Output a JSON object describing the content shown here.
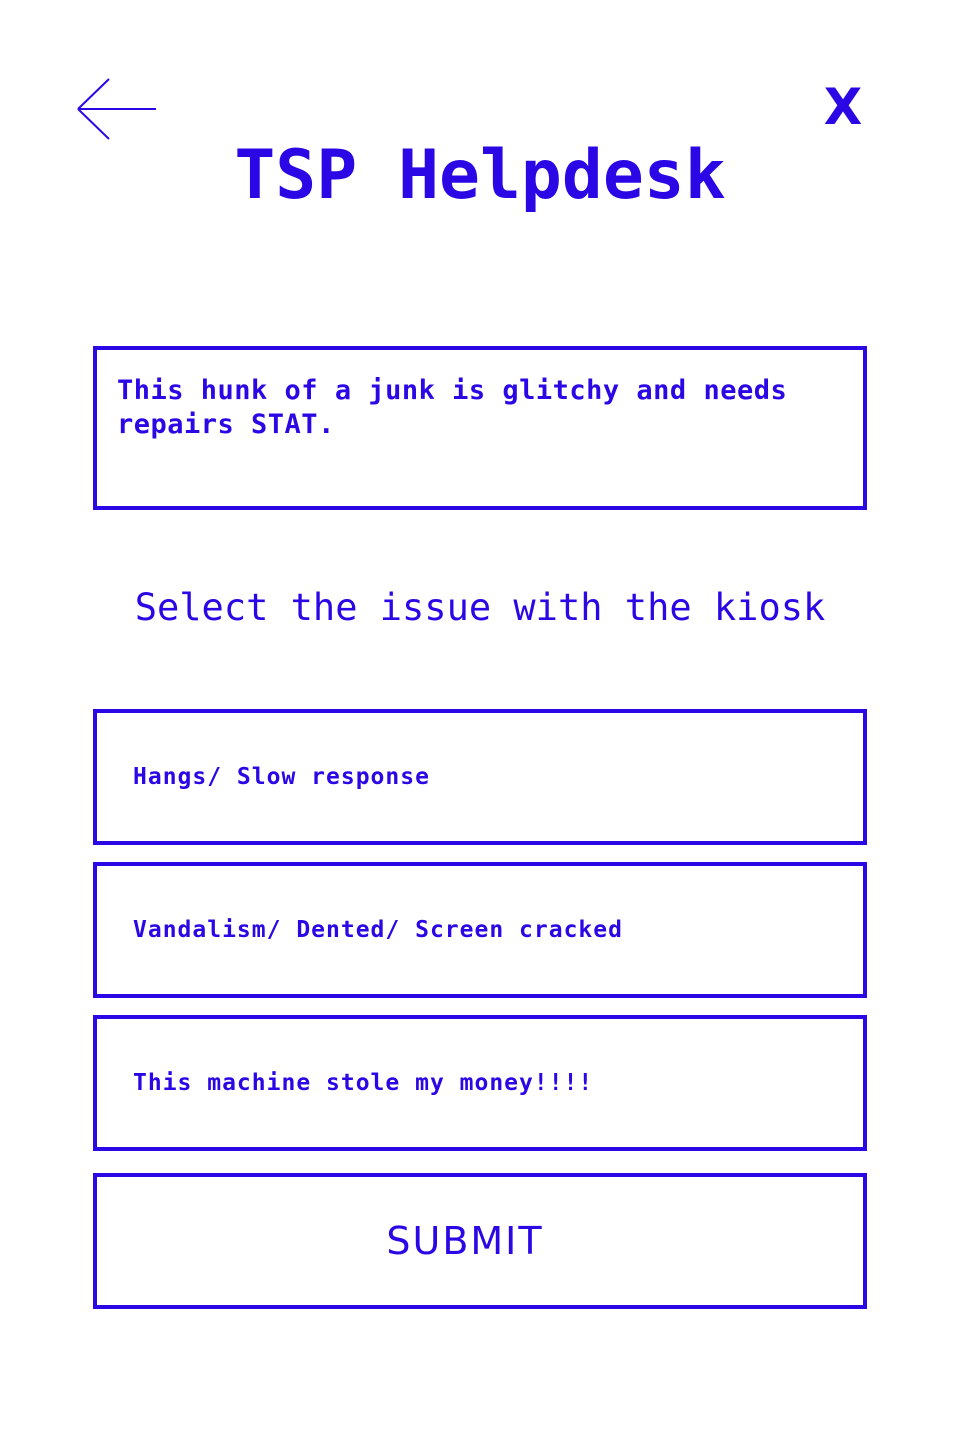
{
  "app": {
    "title": "TSP Helpdesk",
    "accent_color": "#2c07e6",
    "background_color": "#ffffff"
  },
  "header": {
    "back_icon": "arrow-left-icon",
    "close_label": "X"
  },
  "comment": {
    "value": "This hunk of a junk is glitchy and needs repairs STAT."
  },
  "issue_section": {
    "heading": "Select the issue with the kiosk",
    "options": [
      {
        "label": "Hangs/ Slow response"
      },
      {
        "label": "Vandalism/ Dented/ Screen cracked"
      },
      {
        "label": "This machine stole my money!!!!"
      }
    ]
  },
  "actions": {
    "submit_label": "SUBMIT"
  }
}
